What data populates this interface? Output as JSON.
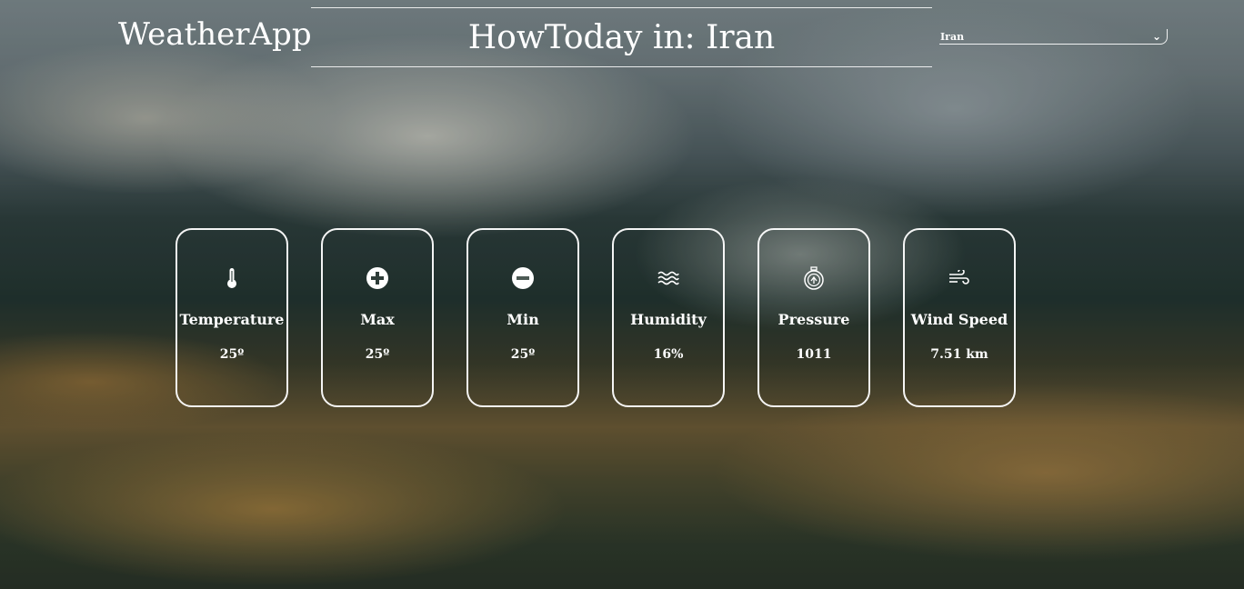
{
  "header": {
    "logo": "WeatherApp",
    "title": "HowToday in: Iran"
  },
  "country_select": {
    "selected": "Iran"
  },
  "cards": [
    {
      "icon": "thermometer-icon",
      "label": "Temperature",
      "value": "25º"
    },
    {
      "icon": "plus-circle-icon",
      "label": "Max",
      "value": "25º"
    },
    {
      "icon": "minus-circle-icon",
      "label": "Min",
      "value": "25º"
    },
    {
      "icon": "water-waves-icon",
      "label": "Humidity",
      "value": "16%"
    },
    {
      "icon": "pressure-gauge-icon",
      "label": "Pressure",
      "value": "1011"
    },
    {
      "icon": "wind-icon",
      "label": "Wind Speed",
      "value": "7.51 km"
    }
  ],
  "colors": {
    "text": "#ffffff",
    "card_border": "#ffffff"
  }
}
